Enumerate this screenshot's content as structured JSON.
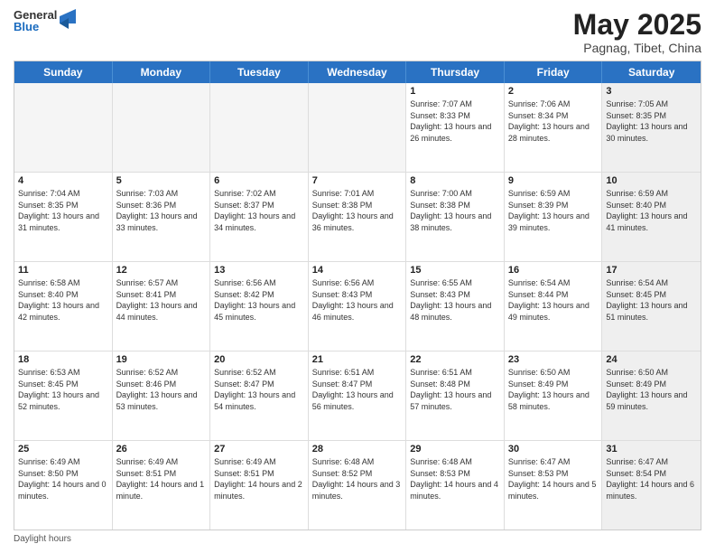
{
  "logo": {
    "general": "General",
    "blue": "Blue"
  },
  "header": {
    "month": "May 2025",
    "location": "Pagnag, Tibet, China"
  },
  "days": [
    "Sunday",
    "Monday",
    "Tuesday",
    "Wednesday",
    "Thursday",
    "Friday",
    "Saturday"
  ],
  "weeks": [
    [
      {
        "day": "",
        "content": "",
        "shaded": true
      },
      {
        "day": "",
        "content": "",
        "shaded": true
      },
      {
        "day": "",
        "content": "",
        "shaded": true
      },
      {
        "day": "",
        "content": "",
        "shaded": true
      },
      {
        "day": "1",
        "content": "Sunrise: 7:07 AM\nSunset: 8:33 PM\nDaylight: 13 hours and 26 minutes.",
        "shaded": false
      },
      {
        "day": "2",
        "content": "Sunrise: 7:06 AM\nSunset: 8:34 PM\nDaylight: 13 hours and 28 minutes.",
        "shaded": false
      },
      {
        "day": "3",
        "content": "Sunrise: 7:05 AM\nSunset: 8:35 PM\nDaylight: 13 hours and 30 minutes.",
        "shaded": true
      }
    ],
    [
      {
        "day": "4",
        "content": "Sunrise: 7:04 AM\nSunset: 8:35 PM\nDaylight: 13 hours and 31 minutes.",
        "shaded": false
      },
      {
        "day": "5",
        "content": "Sunrise: 7:03 AM\nSunset: 8:36 PM\nDaylight: 13 hours and 33 minutes.",
        "shaded": false
      },
      {
        "day": "6",
        "content": "Sunrise: 7:02 AM\nSunset: 8:37 PM\nDaylight: 13 hours and 34 minutes.",
        "shaded": false
      },
      {
        "day": "7",
        "content": "Sunrise: 7:01 AM\nSunset: 8:38 PM\nDaylight: 13 hours and 36 minutes.",
        "shaded": false
      },
      {
        "day": "8",
        "content": "Sunrise: 7:00 AM\nSunset: 8:38 PM\nDaylight: 13 hours and 38 minutes.",
        "shaded": false
      },
      {
        "day": "9",
        "content": "Sunrise: 6:59 AM\nSunset: 8:39 PM\nDaylight: 13 hours and 39 minutes.",
        "shaded": false
      },
      {
        "day": "10",
        "content": "Sunrise: 6:59 AM\nSunset: 8:40 PM\nDaylight: 13 hours and 41 minutes.",
        "shaded": true
      }
    ],
    [
      {
        "day": "11",
        "content": "Sunrise: 6:58 AM\nSunset: 8:40 PM\nDaylight: 13 hours and 42 minutes.",
        "shaded": false
      },
      {
        "day": "12",
        "content": "Sunrise: 6:57 AM\nSunset: 8:41 PM\nDaylight: 13 hours and 44 minutes.",
        "shaded": false
      },
      {
        "day": "13",
        "content": "Sunrise: 6:56 AM\nSunset: 8:42 PM\nDaylight: 13 hours and 45 minutes.",
        "shaded": false
      },
      {
        "day": "14",
        "content": "Sunrise: 6:56 AM\nSunset: 8:43 PM\nDaylight: 13 hours and 46 minutes.",
        "shaded": false
      },
      {
        "day": "15",
        "content": "Sunrise: 6:55 AM\nSunset: 8:43 PM\nDaylight: 13 hours and 48 minutes.",
        "shaded": false
      },
      {
        "day": "16",
        "content": "Sunrise: 6:54 AM\nSunset: 8:44 PM\nDaylight: 13 hours and 49 minutes.",
        "shaded": false
      },
      {
        "day": "17",
        "content": "Sunrise: 6:54 AM\nSunset: 8:45 PM\nDaylight: 13 hours and 51 minutes.",
        "shaded": true
      }
    ],
    [
      {
        "day": "18",
        "content": "Sunrise: 6:53 AM\nSunset: 8:45 PM\nDaylight: 13 hours and 52 minutes.",
        "shaded": false
      },
      {
        "day": "19",
        "content": "Sunrise: 6:52 AM\nSunset: 8:46 PM\nDaylight: 13 hours and 53 minutes.",
        "shaded": false
      },
      {
        "day": "20",
        "content": "Sunrise: 6:52 AM\nSunset: 8:47 PM\nDaylight: 13 hours and 54 minutes.",
        "shaded": false
      },
      {
        "day": "21",
        "content": "Sunrise: 6:51 AM\nSunset: 8:47 PM\nDaylight: 13 hours and 56 minutes.",
        "shaded": false
      },
      {
        "day": "22",
        "content": "Sunrise: 6:51 AM\nSunset: 8:48 PM\nDaylight: 13 hours and 57 minutes.",
        "shaded": false
      },
      {
        "day": "23",
        "content": "Sunrise: 6:50 AM\nSunset: 8:49 PM\nDaylight: 13 hours and 58 minutes.",
        "shaded": false
      },
      {
        "day": "24",
        "content": "Sunrise: 6:50 AM\nSunset: 8:49 PM\nDaylight: 13 hours and 59 minutes.",
        "shaded": true
      }
    ],
    [
      {
        "day": "25",
        "content": "Sunrise: 6:49 AM\nSunset: 8:50 PM\nDaylight: 14 hours and 0 minutes.",
        "shaded": false
      },
      {
        "day": "26",
        "content": "Sunrise: 6:49 AM\nSunset: 8:51 PM\nDaylight: 14 hours and 1 minute.",
        "shaded": false
      },
      {
        "day": "27",
        "content": "Sunrise: 6:49 AM\nSunset: 8:51 PM\nDaylight: 14 hours and 2 minutes.",
        "shaded": false
      },
      {
        "day": "28",
        "content": "Sunrise: 6:48 AM\nSunset: 8:52 PM\nDaylight: 14 hours and 3 minutes.",
        "shaded": false
      },
      {
        "day": "29",
        "content": "Sunrise: 6:48 AM\nSunset: 8:53 PM\nDaylight: 14 hours and 4 minutes.",
        "shaded": false
      },
      {
        "day": "30",
        "content": "Sunrise: 6:47 AM\nSunset: 8:53 PM\nDaylight: 14 hours and 5 minutes.",
        "shaded": false
      },
      {
        "day": "31",
        "content": "Sunrise: 6:47 AM\nSunset: 8:54 PM\nDaylight: 14 hours and 6 minutes.",
        "shaded": true
      }
    ]
  ],
  "footer": {
    "note": "Daylight hours"
  }
}
